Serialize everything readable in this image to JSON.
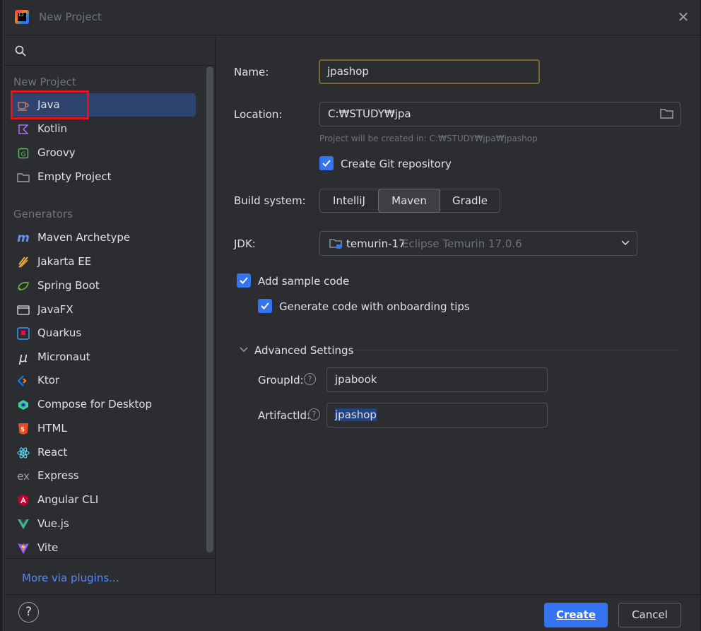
{
  "window": {
    "title": "New Project"
  },
  "sidebar": {
    "section_new": "New Project",
    "new_items": [
      {
        "label": "Java"
      },
      {
        "label": "Kotlin"
      },
      {
        "label": "Groovy"
      },
      {
        "label": "Empty Project"
      }
    ],
    "section_generators": "Generators",
    "generator_items": [
      {
        "label": "Maven Archetype"
      },
      {
        "label": "Jakarta EE"
      },
      {
        "label": "Spring Boot"
      },
      {
        "label": "JavaFX"
      },
      {
        "label": "Quarkus"
      },
      {
        "label": "Micronaut"
      },
      {
        "label": "Ktor"
      },
      {
        "label": "Compose for Desktop"
      },
      {
        "label": "HTML"
      },
      {
        "label": "React"
      },
      {
        "label": "Express"
      },
      {
        "label": "Angular CLI"
      },
      {
        "label": "Vue.js"
      },
      {
        "label": "Vite"
      }
    ],
    "more_plugins": "More via plugins..."
  },
  "form": {
    "name_label": "Name:",
    "name_value": "jpashop",
    "location_label": "Location:",
    "location_value": "C:₩STUDY₩jpa",
    "location_hint": "Project will be created in: C:₩STUDY₩jpa₩jpashop",
    "git_label": "Create Git repository",
    "build_label": "Build system:",
    "build_options": [
      "IntelliJ",
      "Maven",
      "Gradle"
    ],
    "build_selected": "Maven",
    "jdk_label": "JDK:",
    "jdk_name": "temurin-17",
    "jdk_detail": "Eclipse Temurin 17.0.6",
    "sample_code_label": "Add sample code",
    "onboarding_label": "Generate code with onboarding tips",
    "advanced_label": "Advanced Settings",
    "groupid_label": "GroupId:",
    "groupid_value": "jpabook",
    "artifactid_label": "ArtifactId:",
    "artifactid_value": "jpashop"
  },
  "footer": {
    "help_symbol": "?",
    "create_label": "Create",
    "cancel_label": "Cancel"
  },
  "colors": {
    "accent": "#3574f0",
    "selection": "#2e436e",
    "annotation_box": "#e4141c",
    "link": "#548af7"
  }
}
